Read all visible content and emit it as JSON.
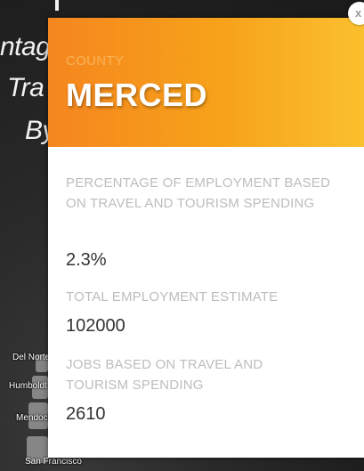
{
  "background": {
    "title_fragments": [
      "ntag",
      "Tra",
      "By",
      "i"
    ],
    "map_labels": [
      "Del Norte",
      "Humboldt",
      "Mendocino",
      "San Francisco"
    ]
  },
  "popup": {
    "close_label": "x",
    "header": {
      "label": "COUNTY",
      "value": "MERCED",
      "gradient_colors": [
        "#f5861f",
        "#fbc02d"
      ]
    },
    "fields": [
      {
        "label": "PERCENTAGE OF EMPLOYMENT BASED ON TRAVEL AND TOURISM SPENDING",
        "value": "2.3%"
      },
      {
        "label": "TOTAL EMPLOYMENT ESTIMATE",
        "value": "102000"
      },
      {
        "label": "JOBS BASED ON TRAVEL AND TOURISM SPENDING",
        "value": "2610"
      }
    ]
  }
}
